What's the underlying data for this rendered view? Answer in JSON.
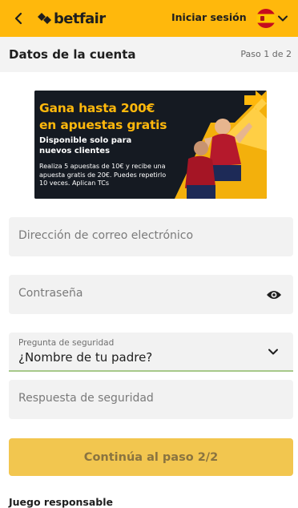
{
  "header": {
    "back_icon": "chevron-left-icon",
    "brand": "betfair",
    "login_label": "Iniciar sesión",
    "language_flag": "spain-flag-icon",
    "colors": {
      "brand_yellow": "#ffb80c",
      "text": "#1e1e1e"
    }
  },
  "subheader": {
    "title": "Datos de la cuenta",
    "step": "Paso 1 de 2"
  },
  "promo": {
    "headline_line1": "Gana hasta 200€",
    "headline_line2": "en apuestas gratis",
    "subline_line1": "Disponible solo para",
    "subline_line2": "nuevos clientes",
    "terms": "Realiza 5 apuestas de 10€ y recibe una apuesta gratis de 20€. Puedes repetirlo 10 veces. Aplican TCs"
  },
  "form": {
    "email_placeholder": "Dirección de correo electrónico",
    "password_placeholder": "Contraseña",
    "security_question_label": "Pregunta de seguridad",
    "security_question_value": "¿Nombre de tu padre?",
    "security_answer_placeholder": "Respuesta de seguridad",
    "continue_label": "Continúa al paso 2/2"
  },
  "footer": {
    "responsible_gaming": "Juego responsable"
  }
}
